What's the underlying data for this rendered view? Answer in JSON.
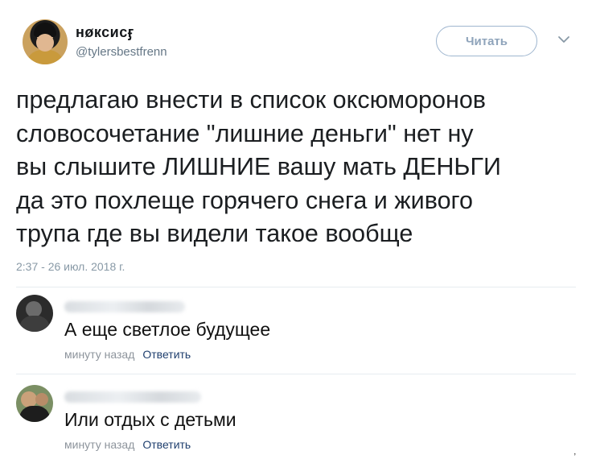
{
  "tweet": {
    "display_name": "нøксисӻ",
    "handle": "@tylersbestfrenn",
    "follow_label": "Читать",
    "lines": [
      "предлагаю внести в список оксюморонов",
      "словосочетание \"лишние деньги\" нет ну",
      "вы слышите ЛИШНИЕ вашу мать ДЕНЬГИ",
      "да это похлеще горячего снега и живого",
      "трупа где вы видели такое вообще"
    ],
    "timestamp": "2:37 - 26 июл. 2018 г."
  },
  "comments": [
    {
      "text": "А еще светлое будущее",
      "time": "минуту назад",
      "reply_label": "Ответить"
    },
    {
      "text": "Или отдых с детьми",
      "time": "минуту назад",
      "reply_label": "Ответить"
    }
  ],
  "icons": {
    "menu": "chevron-down-icon"
  },
  "colors": {
    "follow_border": "#9fb6cf",
    "reply_link": "#1f3f6e",
    "meta_gray": "#8d949c"
  }
}
